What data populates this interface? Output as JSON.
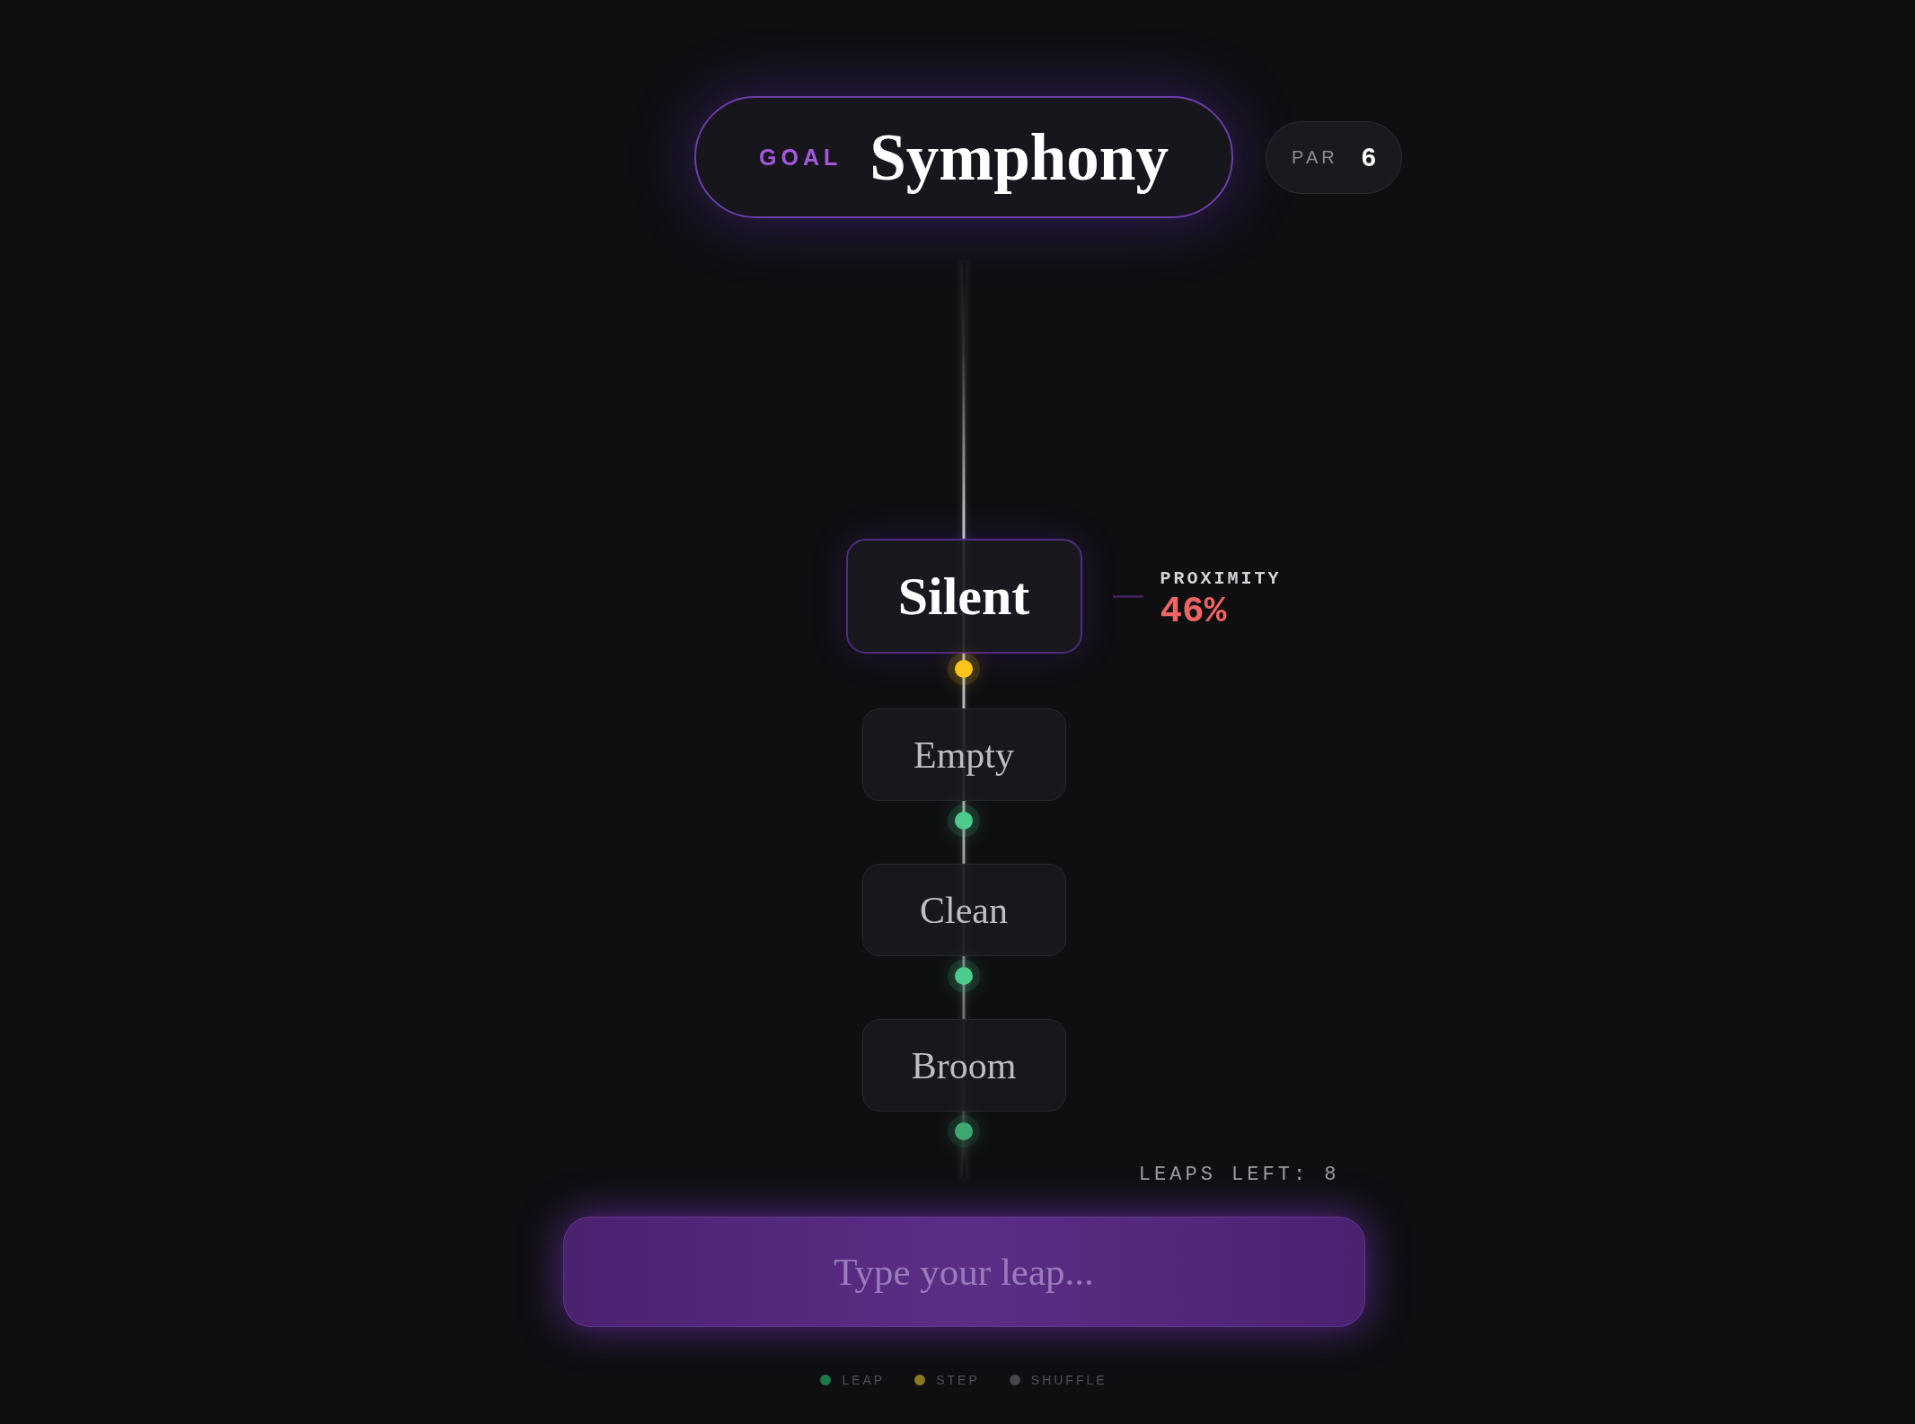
{
  "goal": {
    "label": "GOAL",
    "word": "Symphony"
  },
  "par": {
    "label": "PAR",
    "value": "6"
  },
  "path": [
    {
      "word": "Silent",
      "current": true,
      "color": "#fbc51a"
    },
    {
      "word": "Empty",
      "current": false,
      "color": "#4ccb8d"
    },
    {
      "word": "Clean",
      "current": false,
      "color": "#4ccb8d"
    },
    {
      "word": "Broom",
      "current": false,
      "color": "#3fa872"
    }
  ],
  "proximity": {
    "label": "PROXIMITY",
    "value": "46%"
  },
  "leaps_left": "LEAPS LEFT: 8",
  "input": {
    "placeholder": "Type your leap..."
  },
  "legend": [
    {
      "label": "LEAP",
      "color": "#1b7a4b"
    },
    {
      "label": "STEP",
      "color": "#8c7a22"
    },
    {
      "label": "SHUFFLE",
      "color": "#46464c"
    }
  ]
}
